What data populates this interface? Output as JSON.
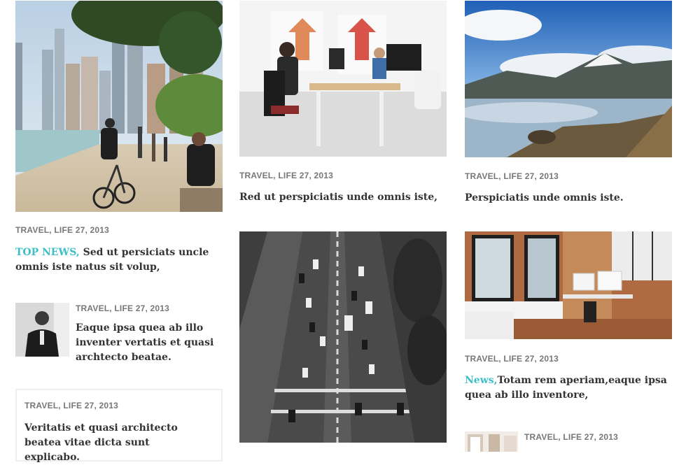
{
  "colors": {
    "accent": "#3cbfc9",
    "meta": "#777777",
    "title": "#333333",
    "box_border": "#eeeeee"
  },
  "col1": {
    "feature": {
      "image": "city-lakefront-cyclist-photo",
      "meta": "TRAVEL, LIFE 27, 2013",
      "tag": "TOP NEWS,",
      "title": " Sed ut persiciats uncle omnis iste natus sit volup,"
    },
    "small_post": {
      "image": "man-portrait-photo",
      "meta": "TRAVEL, LIFE 27, 2013",
      "title": "Eaque ipsa quea ab illo inventer vertatis et quasi archtecto beatae."
    },
    "boxed_post": {
      "meta": "TRAVEL, LIFE 27, 2013",
      "title": "Veritatis et quasi architecto beatea vitae dicta sunt explicabo."
    }
  },
  "col2": {
    "post_top": {
      "image": "office-workspace-photo",
      "meta": "TRAVEL, LIFE 27, 2013",
      "title": "Red ut perspiciatis unde omnis iste,"
    },
    "post_bottom": {
      "image": "city-street-aerial-photo"
    }
  },
  "col3": {
    "post_top": {
      "image": "mountain-lake-photo",
      "meta": "TRAVEL, LIFE 27, 2013",
      "title": "Perspiciatis unde omnis iste."
    },
    "post_mid": {
      "image": "loft-home-office-photo",
      "meta": "TRAVEL, LIFE 27, 2013",
      "tag": "News,",
      "title": "Totam rem aperiam,eaque ipsa quea ab illo inventore,"
    },
    "small_post": {
      "image": "interior-room-photo",
      "meta": "TRAVEL, LIFE 27, 2013"
    }
  }
}
